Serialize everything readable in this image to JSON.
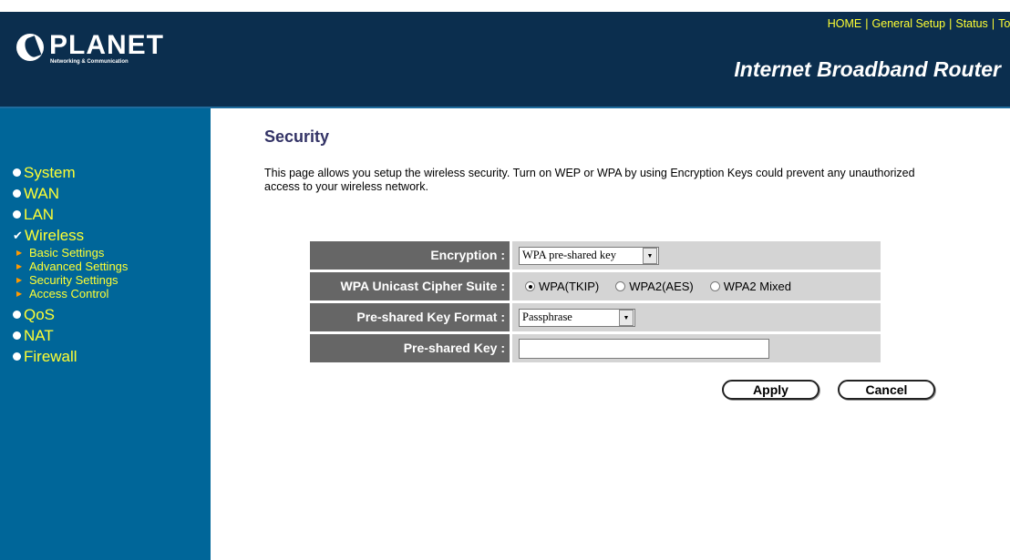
{
  "header": {
    "logo_text": "PLANET",
    "logo_subtitle": "Networking & Communication",
    "nav": [
      "HOME",
      "General Setup",
      "Status",
      "Tool"
    ],
    "product_title": "Internet Broadband Router"
  },
  "sidebar": {
    "items": [
      {
        "label": "System",
        "icon": "bullet-icon"
      },
      {
        "label": "WAN",
        "icon": "bullet-icon"
      },
      {
        "label": "LAN",
        "icon": "bullet-icon"
      },
      {
        "label": "Wireless",
        "icon": "check-icon"
      },
      {
        "label": "QoS",
        "icon": "bullet-icon"
      },
      {
        "label": "NAT",
        "icon": "bullet-icon"
      },
      {
        "label": "Firewall",
        "icon": "bullet-icon"
      }
    ],
    "wireless_sub": [
      "Basic Settings",
      "Advanced Settings",
      "Security Settings",
      "Access Control"
    ]
  },
  "main": {
    "title": "Security",
    "description": "This page allows you setup the wireless security. Turn on WEP or WPA by using Encryption Keys could prevent any unauthorized access to your wireless network.",
    "encryption": {
      "label": "Encryption :",
      "value": "WPA pre-shared key"
    },
    "cipher": {
      "label": "WPA Unicast Cipher Suite :",
      "options": [
        "WPA(TKIP)",
        "WPA2(AES)",
        "WPA2 Mixed"
      ],
      "selected": "WPA(TKIP)"
    },
    "key_format": {
      "label": "Pre-shared Key Format :",
      "value": "Passphrase"
    },
    "psk": {
      "label": "Pre-shared Key :",
      "value": ""
    },
    "apply_label": "Apply",
    "cancel_label": "Cancel"
  },
  "colors": {
    "header_bg": "#0b2e4e",
    "sidebar_bg": "#006699",
    "nav_text": "#ffff33",
    "label_bg": "#666666",
    "value_bg": "#d4d4d4"
  }
}
